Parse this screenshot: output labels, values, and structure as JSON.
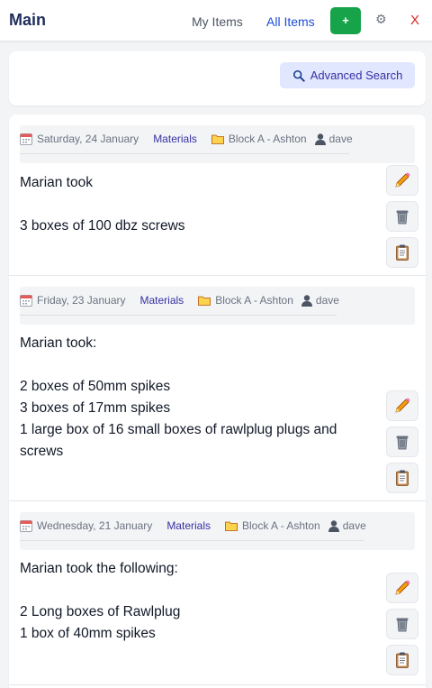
{
  "header": {
    "title": "Main",
    "nav_my_items": "My Items",
    "nav_all_items": "All Items",
    "add_label": "+",
    "settings_glyph": "⚙",
    "close_label": "X"
  },
  "search": {
    "advanced_label": "Advanced Search"
  },
  "entries": [
    {
      "date": "Saturday, 24 January",
      "category": "Materials",
      "location": "Block A - Ashton",
      "user": "dave",
      "lines": [
        "Marian took",
        "",
        "3 boxes of 100 dbz screws"
      ]
    },
    {
      "date": "Friday, 23 January",
      "category": "Materials",
      "location": "Block A - Ashton",
      "user": "dave",
      "lines": [
        "Marian took:",
        "",
        "2 boxes of 50mm spikes",
        "3 boxes of 17mm spikes",
        "1 large box of 16 small boxes of rawlplug plugs and",
        "screws"
      ]
    },
    {
      "date": "Wednesday, 21 January",
      "category": "Materials",
      "location": "Block A - Ashton",
      "user": "dave",
      "lines": [
        "Marian took the following:",
        "",
        "2 Long boxes of Rawlplug",
        "1 box of 40mm spikes"
      ]
    }
  ],
  "colors": {
    "brand": "#1f2d5c",
    "add_button": "#16a34a",
    "close": "#dc2626",
    "link_active": "#1d4ed8",
    "category": "#3730a3",
    "advanced_bg": "#e0e7ff"
  },
  "icons": {
    "calendar": "calendar-icon",
    "folder": "folder-icon",
    "user": "user-icon",
    "edit": "pencil-icon",
    "delete": "trash-icon",
    "copy": "clipboard-icon",
    "search": "magnifier-icon",
    "settings": "gear-icon"
  }
}
